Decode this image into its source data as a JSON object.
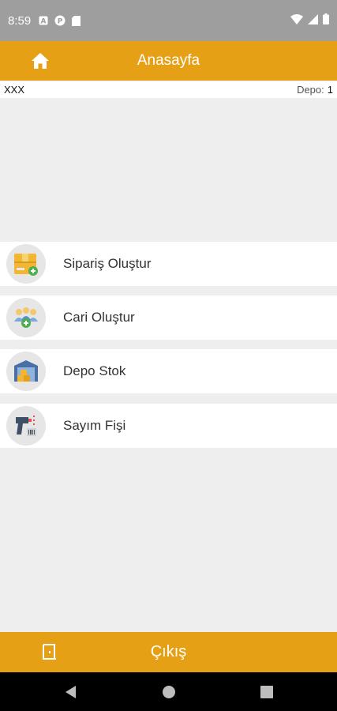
{
  "status_bar": {
    "time": "8:59",
    "icons": [
      "a-square-icon",
      "p-circle-icon",
      "sd-card-icon",
      "wifi-icon",
      "signal-icon",
      "battery-icon"
    ]
  },
  "app_bar": {
    "title": "Anasayfa",
    "home_icon": "home-icon"
  },
  "info_bar": {
    "user": "XXX",
    "depo_label": "Depo:",
    "depo_value": "1"
  },
  "menu": {
    "items": [
      {
        "label": "Sipariş Oluştur",
        "icon": "order-box-icon"
      },
      {
        "label": "Cari Oluştur",
        "icon": "customers-add-icon"
      },
      {
        "label": "Depo Stok",
        "icon": "warehouse-icon"
      },
      {
        "label": "Sayım Fişi",
        "icon": "barcode-scanner-icon"
      }
    ]
  },
  "bottom_bar": {
    "label": "Çıkış",
    "icon": "exit-door-icon"
  },
  "colors": {
    "accent": "#e5a016",
    "background": "#eeeeee",
    "status_bar": "#9e9e9e"
  }
}
